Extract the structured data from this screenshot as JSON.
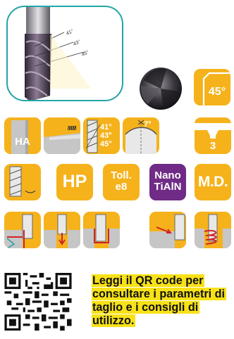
{
  "icons": {
    "ha_label": "HA",
    "face_angle_label": "7°",
    "helix_angles": [
      "41°",
      "43°",
      "45°"
    ],
    "flute_count_label": "3",
    "hp_label": "HP",
    "tolerance_label": "Toll.\ne8",
    "coating_label": "Nano\nTiAlN",
    "md_label": "M.D.",
    "chamfer_label": "45°"
  },
  "colors": {
    "tile": "#f5b21b",
    "tile_gray": "#c6c6c6",
    "frame": "#22a4a8",
    "caption_highlight": "#f7e117",
    "coating_tile": "#6f2b86"
  },
  "qr_caption": "Leggi il QR code per consultare i parametri di taglio e i consigli di utilizzo."
}
